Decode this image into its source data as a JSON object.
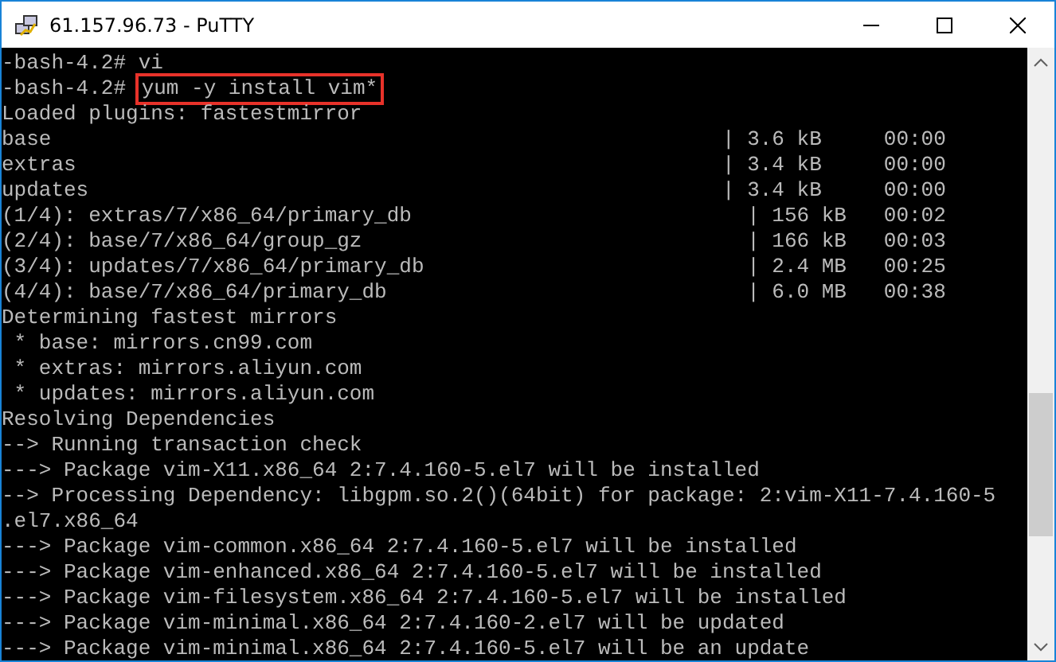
{
  "window": {
    "title": "61.157.96.73 - PuTTY"
  },
  "terminal": {
    "lines": [
      {
        "kind": "prompt",
        "prompt": "-bash-4.2#",
        "command": "vi",
        "highlighted": false
      },
      {
        "kind": "prompt",
        "prompt": "-bash-4.2#",
        "command": "yum -y install vim*",
        "highlighted": true
      },
      {
        "kind": "output",
        "text": "Loaded plugins: fastestmirror"
      },
      {
        "kind": "output",
        "text": "base                                                      | 3.6 kB     00:00"
      },
      {
        "kind": "output",
        "text": "extras                                                    | 3.4 kB     00:00"
      },
      {
        "kind": "output",
        "text": "updates                                                   | 3.4 kB     00:00"
      },
      {
        "kind": "output",
        "text": "(1/4): extras/7/x86_64/primary_db                           | 156 kB   00:02"
      },
      {
        "kind": "output",
        "text": "(2/4): base/7/x86_64/group_gz                               | 166 kB   00:03"
      },
      {
        "kind": "output",
        "text": "(3/4): updates/7/x86_64/primary_db                          | 2.4 MB   00:25"
      },
      {
        "kind": "output",
        "text": "(4/4): base/7/x86_64/primary_db                             | 6.0 MB   00:38"
      },
      {
        "kind": "output",
        "text": "Determining fastest mirrors"
      },
      {
        "kind": "output",
        "text": " * base: mirrors.cn99.com"
      },
      {
        "kind": "output",
        "text": " * extras: mirrors.aliyun.com"
      },
      {
        "kind": "output",
        "text": " * updates: mirrors.aliyun.com"
      },
      {
        "kind": "output",
        "text": "Resolving Dependencies"
      },
      {
        "kind": "output",
        "text": "--> Running transaction check"
      },
      {
        "kind": "output",
        "text": "---> Package vim-X11.x86_64 2:7.4.160-5.el7 will be installed"
      },
      {
        "kind": "output",
        "text": "--> Processing Dependency: libgpm.so.2()(64bit) for package: 2:vim-X11-7.4.160-5"
      },
      {
        "kind": "output",
        "text": ".el7.x86_64"
      },
      {
        "kind": "output",
        "text": "---> Package vim-common.x86_64 2:7.4.160-5.el7 will be installed"
      },
      {
        "kind": "output",
        "text": "---> Package vim-enhanced.x86_64 2:7.4.160-5.el7 will be installed"
      },
      {
        "kind": "output",
        "text": "---> Package vim-filesystem.x86_64 2:7.4.160-5.el7 will be installed"
      },
      {
        "kind": "output",
        "text": "---> Package vim-minimal.x86_64 2:7.4.160-2.el7 will be updated"
      },
      {
        "kind": "output",
        "text": "---> Package vim-minimal.x86_64 2:7.4.160-5.el7 will be an update"
      }
    ]
  }
}
